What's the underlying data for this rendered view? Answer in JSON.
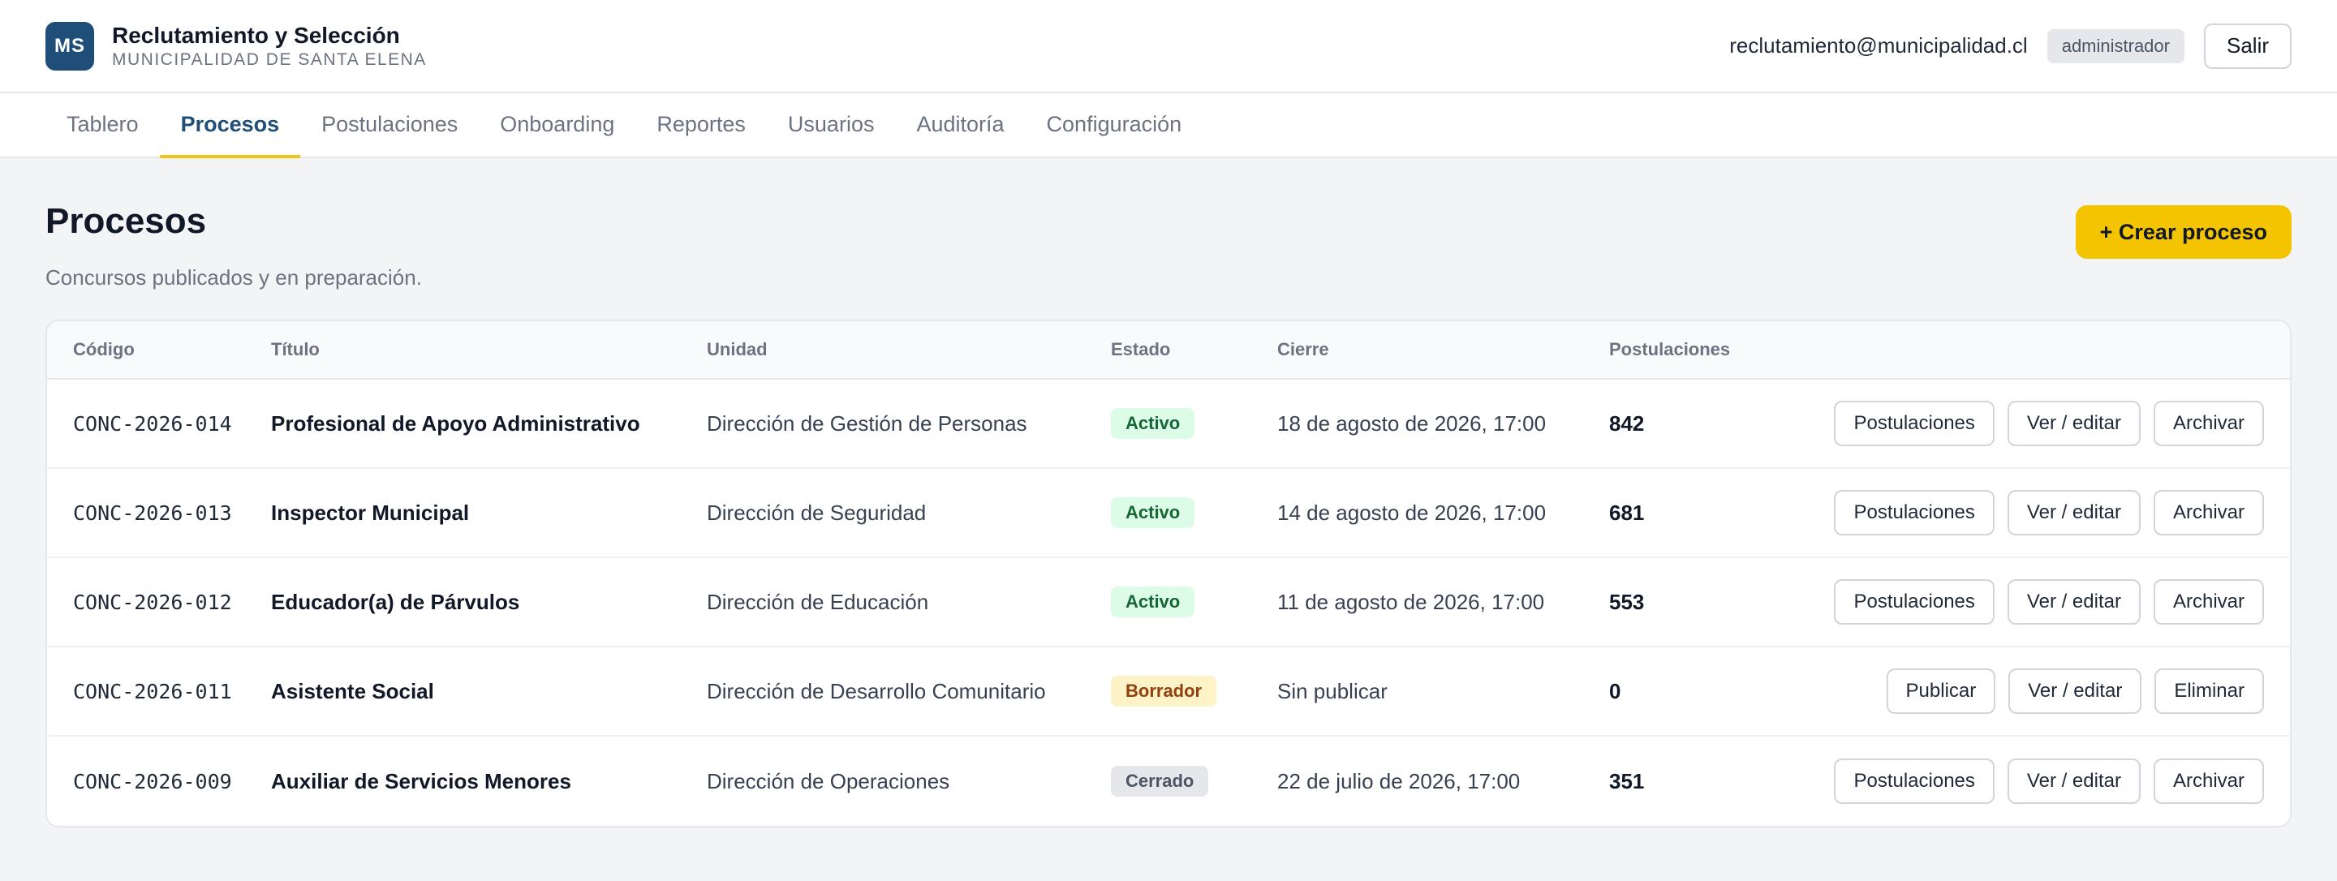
{
  "header": {
    "logo_text": "MS",
    "title": "Reclutamiento y Selección",
    "subtitle": "MUNICIPALIDAD DE SANTA ELENA",
    "user_email": "reclutamiento@municipalidad.cl",
    "role": "administrador",
    "logout_label": "Salir"
  },
  "nav": {
    "active": "Procesos",
    "tabs": [
      "Tablero",
      "Procesos",
      "Postulaciones",
      "Onboarding",
      "Reportes",
      "Usuarios",
      "Auditoría",
      "Configuración"
    ]
  },
  "page": {
    "title": "Procesos",
    "subtitle": "Concursos publicados y en preparación.",
    "create_label": "+ Crear proceso"
  },
  "table": {
    "columns": [
      "Código",
      "Título",
      "Unidad",
      "Estado",
      "Cierre",
      "Postulaciones"
    ],
    "rows": [
      {
        "code": "CONC-2026-014",
        "title": "Profesional de Apoyo Administrativo",
        "unit": "Dirección de Gestión de Personas",
        "state": "Activo",
        "state_kind": "activo",
        "close": "18 de agosto de 2026, 17:00",
        "applications": "842",
        "actions": [
          "Postulaciones",
          "Ver / editar",
          "Archivar"
        ]
      },
      {
        "code": "CONC-2026-013",
        "title": "Inspector Municipal",
        "unit": "Dirección de Seguridad",
        "state": "Activo",
        "state_kind": "activo",
        "close": "14 de agosto de 2026, 17:00",
        "applications": "681",
        "actions": [
          "Postulaciones",
          "Ver / editar",
          "Archivar"
        ]
      },
      {
        "code": "CONC-2026-012",
        "title": "Educador(a) de Párvulos",
        "unit": "Dirección de Educación",
        "state": "Activo",
        "state_kind": "activo",
        "close": "11 de agosto de 2026, 17:00",
        "applications": "553",
        "actions": [
          "Postulaciones",
          "Ver / editar",
          "Archivar"
        ]
      },
      {
        "code": "CONC-2026-011",
        "title": "Asistente Social",
        "unit": "Dirección de Desarrollo Comunitario",
        "state": "Borrador",
        "state_kind": "borrador",
        "close": "Sin publicar",
        "applications": "0",
        "actions": [
          "Publicar",
          "Ver / editar",
          "Eliminar"
        ]
      },
      {
        "code": "CONC-2026-009",
        "title": "Auxiliar de Servicios Menores",
        "unit": "Dirección de Operaciones",
        "state": "Cerrado",
        "state_kind": "cerrado",
        "close": "22 de julio de 2026, 17:00",
        "applications": "351",
        "actions": [
          "Postulaciones",
          "Ver / editar",
          "Archivar"
        ]
      }
    ]
  },
  "colors": {
    "brand": "#1f4e79",
    "accent": "#f5c400",
    "active_badge": "#dcfce7",
    "draft_badge": "#fef3c7",
    "closed_badge": "#e5e7eb"
  }
}
